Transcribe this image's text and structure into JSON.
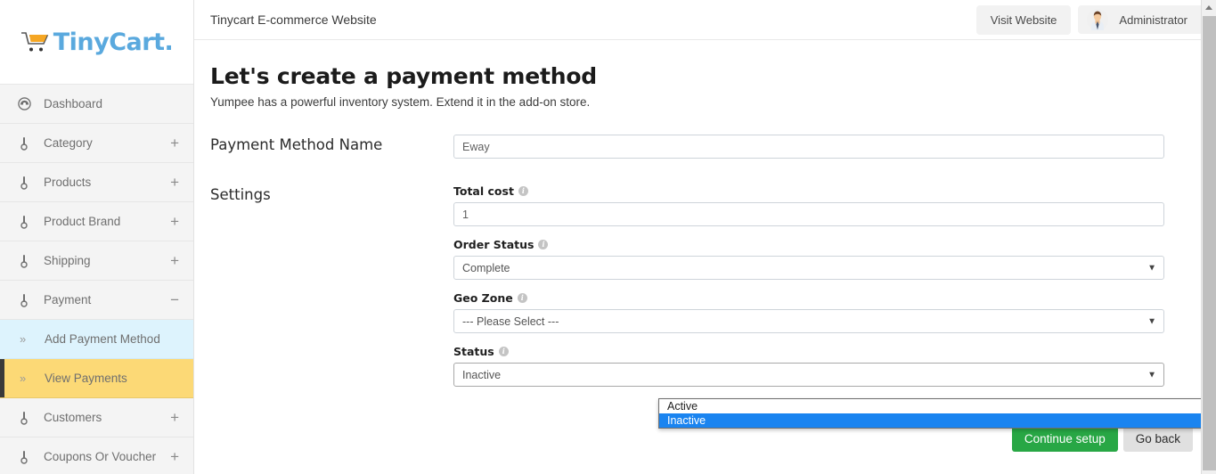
{
  "brand": {
    "logo_text": "TinyCart.",
    "logo_icon": "shopping-cart-icon",
    "logo_color": "#5aa9de",
    "cart_color": "#f5a623"
  },
  "header": {
    "site_title": "Tinycart E-commerce Website",
    "visit_website_label": "Visit Website",
    "user_name": "Administrator",
    "avatar_icon": "user-avatar-icon"
  },
  "sidebar": {
    "items": [
      {
        "label": "Dashboard",
        "icon": "dashboard-gauge-icon",
        "toggle": ""
      },
      {
        "label": "Category",
        "icon": "thermometer-icon",
        "toggle": "+"
      },
      {
        "label": "Products",
        "icon": "thermometer-icon",
        "toggle": "+"
      },
      {
        "label": "Product Brand",
        "icon": "thermometer-icon",
        "toggle": "+"
      },
      {
        "label": "Shipping",
        "icon": "thermometer-icon",
        "toggle": "+"
      },
      {
        "label": "Payment",
        "icon": "thermometer-icon",
        "toggle": "−"
      }
    ],
    "payment_children": [
      {
        "label": "Add Payment Method",
        "chevron": "»",
        "state": "hover"
      },
      {
        "label": "View Payments",
        "chevron": "»",
        "state": "active"
      }
    ],
    "items_after": [
      {
        "label": "Customers",
        "icon": "thermometer-icon",
        "toggle": "+"
      },
      {
        "label": "Coupons Or Voucher",
        "icon": "thermometer-icon",
        "toggle": "+"
      }
    ],
    "colors": {
      "hover_bg": "#ddf3fd",
      "active_bg": "#fcd976",
      "active_marker": "#3a3a3a"
    }
  },
  "main": {
    "page_title": "Let's create a payment method",
    "page_subtitle": "Yumpee has a powerful inventory system. Extend it in the add-on store.",
    "name_section": {
      "label": "Payment Method Name",
      "value": "Eway",
      "placeholder": "Eway"
    },
    "settings_section": {
      "label": "Settings",
      "fields": [
        {
          "label": "Total cost",
          "info_icon": "info-circle-icon",
          "type": "text",
          "value": "1"
        },
        {
          "label": "Order Status",
          "info_icon": "info-circle-icon",
          "type": "select",
          "value": "Complete"
        },
        {
          "label": "Geo Zone",
          "info_icon": "info-circle-icon",
          "type": "select",
          "value": "--- Please Select ---"
        },
        {
          "label": "Status",
          "info_icon": "info-circle-icon",
          "type": "select",
          "value": "Inactive",
          "open": true,
          "options": [
            "Active",
            "Inactive"
          ],
          "highlighted_option": "Inactive"
        }
      ]
    },
    "buttons": {
      "continue_label": "Continue setup",
      "goback_label": "Go back",
      "continue_color": "#28a745"
    }
  },
  "scrollbar": {
    "up_arrow_icon": "arrow-up-icon",
    "thumb_icon": "scroll-thumb"
  }
}
